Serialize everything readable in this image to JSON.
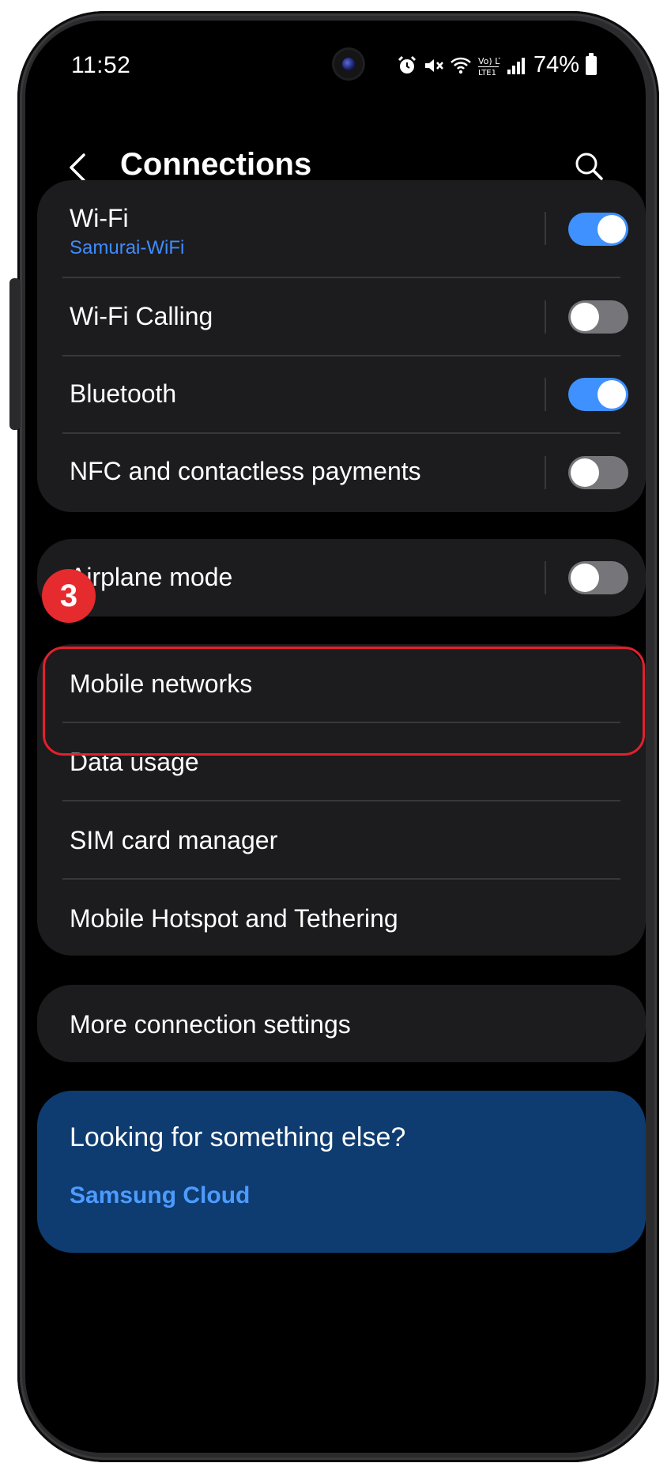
{
  "status_bar": {
    "time": "11:52",
    "network_label": "Vo) LTE1",
    "battery_percent": "74%",
    "icons": [
      "alarm-icon",
      "mute-icon",
      "wifi-icon",
      "volte-icon",
      "signal-icon",
      "battery-icon"
    ]
  },
  "header": {
    "title": "Connections",
    "icons": [
      "back-arrow-icon",
      "search-icon"
    ]
  },
  "group1": [
    {
      "label": "Wi-Fi",
      "sub": "Samurai-WiFi",
      "toggle": "on"
    },
    {
      "label": "Wi-Fi Calling",
      "toggle": "off"
    },
    {
      "label": "Bluetooth",
      "toggle": "on"
    },
    {
      "label": "NFC and contactless payments",
      "toggle": "off"
    }
  ],
  "group2": [
    {
      "label": "Airplane mode",
      "toggle": "off"
    }
  ],
  "group3": [
    {
      "label": "Mobile networks"
    },
    {
      "label": "Data usage"
    },
    {
      "label": "SIM card manager"
    },
    {
      "label": "Mobile Hotspot and Tethering"
    }
  ],
  "group4": [
    {
      "label": "More connection settings"
    }
  ],
  "suggestion": {
    "question": "Looking for something else?",
    "link": "Samsung Cloud"
  },
  "annotation": {
    "step": "3",
    "highlight_color": "#e3202b"
  },
  "colors": {
    "accent": "#3e91ff",
    "card_background": "#1c1c1e",
    "suggestion_background": "#0e3c70"
  }
}
